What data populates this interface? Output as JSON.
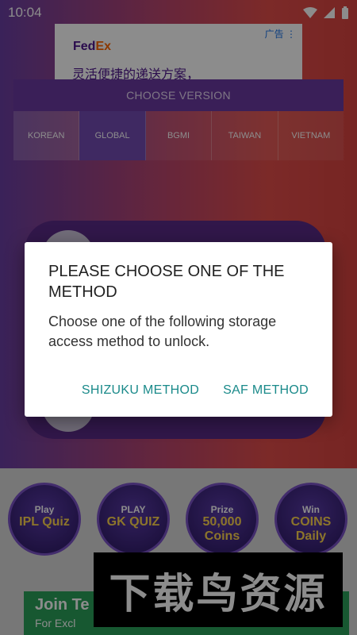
{
  "status": {
    "time": "10:04"
  },
  "ad": {
    "brand_a": "Fed",
    "brand_b": "Ex",
    "tag": "广告",
    "text": "灵活便捷的递送方案，"
  },
  "version": {
    "title": "CHOOSE VERSION",
    "tabs": [
      "KOREAN",
      "GLOBAL",
      "BGMI",
      "TAIWAN",
      "VIETNAM"
    ]
  },
  "games": [
    {
      "l1": "Play",
      "l2": "IPL Quiz"
    },
    {
      "l1": "PLAY",
      "l2": "GK QUIZ"
    },
    {
      "l1": "Prize",
      "l2": "50,000 Coins"
    },
    {
      "l1": "Win",
      "l2": "COINS Daily"
    }
  ],
  "promo": {
    "heading": "Join Te",
    "sub": "For Excl"
  },
  "watermark": "下载鸟资源",
  "dialog": {
    "title": "PLEASE CHOOSE ONE OF THE METHOD",
    "message": "Choose one of the following storage access method to unlock.",
    "btn_shizuku": "SHIZUKU METHOD",
    "btn_saf": "SAF METHOD"
  },
  "colors": {
    "accent": "#1a8a8a",
    "purple": "#6b3aa0"
  }
}
